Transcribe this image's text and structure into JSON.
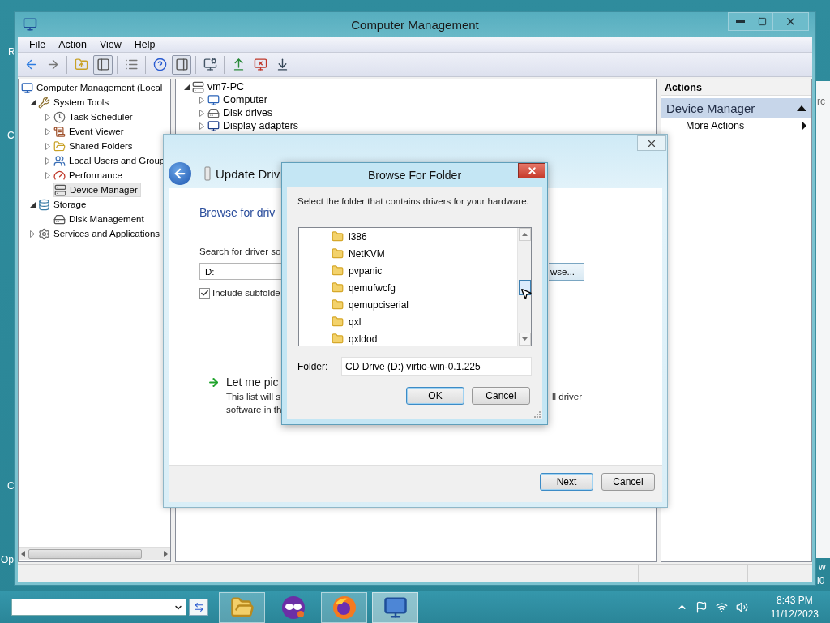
{
  "window": {
    "title": "Computer Management",
    "menu": [
      "File",
      "Action",
      "View",
      "Help"
    ]
  },
  "desktop_labels": [
    {
      "text": "R"
    },
    {
      "text": "C"
    },
    {
      "text": "C"
    },
    {
      "text": "Op"
    },
    {
      "text": "rc"
    },
    {
      "text": "w"
    },
    {
      "text": "i0"
    }
  ],
  "navigation_tree": [
    {
      "label": "Computer Management (Local",
      "expandable": false,
      "selected": false,
      "children": [
        {
          "label": "System Tools",
          "expandable": true,
          "expanded": true,
          "selected": false,
          "children": [
            {
              "label": "Task Scheduler",
              "expandable": true,
              "expanded": false,
              "selected": false
            },
            {
              "label": "Event Viewer",
              "expandable": true,
              "expanded": false,
              "selected": false
            },
            {
              "label": "Shared Folders",
              "expandable": true,
              "expanded": false,
              "selected": false
            },
            {
              "label": "Local Users and Group",
              "expandable": true,
              "expanded": false,
              "selected": false
            },
            {
              "label": "Performance",
              "expandable": true,
              "expanded": false,
              "selected": false
            },
            {
              "label": "Device Manager",
              "expandable": false,
              "selected": true
            }
          ]
        },
        {
          "label": "Storage",
          "expandable": true,
          "expanded": true,
          "selected": false,
          "children": [
            {
              "label": "Disk Management",
              "expandable": false,
              "selected": false
            }
          ]
        },
        {
          "label": "Services and Applications",
          "expandable": true,
          "expanded": false,
          "selected": false
        }
      ]
    }
  ],
  "device_tree": [
    {
      "label": "vm7-PC",
      "expandable": true,
      "expanded": true,
      "children": [
        {
          "label": "Computer",
          "expandable": true,
          "expanded": false
        },
        {
          "label": "Disk drives",
          "expandable": true,
          "expanded": false
        },
        {
          "label": "Display adapters",
          "expandable": true,
          "expanded": false
        }
      ]
    }
  ],
  "actions": {
    "header": "Actions",
    "section": {
      "title": "Device Manager",
      "expanded": true,
      "items": [
        {
          "label": "More Actions"
        }
      ]
    }
  },
  "update_driver": {
    "title": "Update Driv",
    "heading": "Browse for driv",
    "search_label": "Search for driver so",
    "path_field": {
      "value": "D:"
    },
    "browse_button": "wse...",
    "include_subfolders": {
      "label": "Include subfolde",
      "checked": true
    },
    "pick_option": {
      "title": "Let me pic",
      "description_left": [
        "This list will s",
        "software in th"
      ],
      "description_right": "ll driver"
    },
    "buttons": [
      "Next",
      "Cancel"
    ]
  },
  "browse_dialog": {
    "title": "Browse For Folder",
    "instruction": "Select the folder that contains drivers for your hardware.",
    "folders": [
      "i386",
      "NetKVM",
      "pvpanic",
      "qemufwcfg",
      "qemupciserial",
      "qxl",
      "qxldod"
    ],
    "folder_label": "Folder:",
    "folder_field": {
      "value": "CD Drive (D:) virtio-win-0.1.225"
    },
    "buttons": [
      {
        "label": "OK",
        "default": true
      },
      {
        "label": "Cancel",
        "default": false
      }
    ]
  },
  "taskbar": {
    "apps": [
      {
        "open": true,
        "active": false
      },
      {
        "open": false,
        "active": false
      },
      {
        "open": true,
        "active": false
      },
      {
        "open": true,
        "active": true
      }
    ],
    "clock": {
      "time": "8:43 PM",
      "date": "11/12/2023"
    }
  }
}
